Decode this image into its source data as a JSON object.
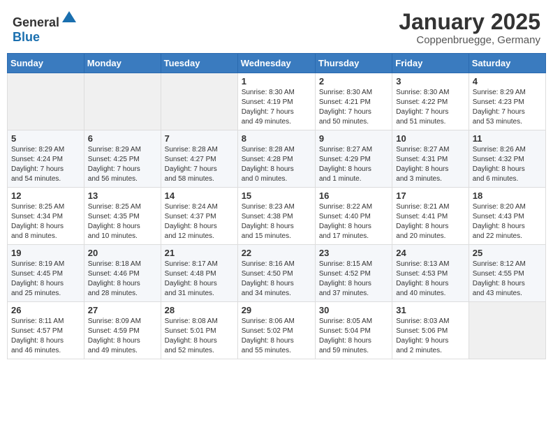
{
  "header": {
    "logo_general": "General",
    "logo_blue": "Blue",
    "title": "January 2025",
    "subtitle": "Coppenbruegge, Germany"
  },
  "weekdays": [
    "Sunday",
    "Monday",
    "Tuesday",
    "Wednesday",
    "Thursday",
    "Friday",
    "Saturday"
  ],
  "weeks": [
    [
      {
        "day": "",
        "info": ""
      },
      {
        "day": "",
        "info": ""
      },
      {
        "day": "",
        "info": ""
      },
      {
        "day": "1",
        "info": "Sunrise: 8:30 AM\nSunset: 4:19 PM\nDaylight: 7 hours\nand 49 minutes."
      },
      {
        "day": "2",
        "info": "Sunrise: 8:30 AM\nSunset: 4:21 PM\nDaylight: 7 hours\nand 50 minutes."
      },
      {
        "day": "3",
        "info": "Sunrise: 8:30 AM\nSunset: 4:22 PM\nDaylight: 7 hours\nand 51 minutes."
      },
      {
        "day": "4",
        "info": "Sunrise: 8:29 AM\nSunset: 4:23 PM\nDaylight: 7 hours\nand 53 minutes."
      }
    ],
    [
      {
        "day": "5",
        "info": "Sunrise: 8:29 AM\nSunset: 4:24 PM\nDaylight: 7 hours\nand 54 minutes."
      },
      {
        "day": "6",
        "info": "Sunrise: 8:29 AM\nSunset: 4:25 PM\nDaylight: 7 hours\nand 56 minutes."
      },
      {
        "day": "7",
        "info": "Sunrise: 8:28 AM\nSunset: 4:27 PM\nDaylight: 7 hours\nand 58 minutes."
      },
      {
        "day": "8",
        "info": "Sunrise: 8:28 AM\nSunset: 4:28 PM\nDaylight: 8 hours\nand 0 minutes."
      },
      {
        "day": "9",
        "info": "Sunrise: 8:27 AM\nSunset: 4:29 PM\nDaylight: 8 hours\nand 1 minute."
      },
      {
        "day": "10",
        "info": "Sunrise: 8:27 AM\nSunset: 4:31 PM\nDaylight: 8 hours\nand 3 minutes."
      },
      {
        "day": "11",
        "info": "Sunrise: 8:26 AM\nSunset: 4:32 PM\nDaylight: 8 hours\nand 6 minutes."
      }
    ],
    [
      {
        "day": "12",
        "info": "Sunrise: 8:25 AM\nSunset: 4:34 PM\nDaylight: 8 hours\nand 8 minutes."
      },
      {
        "day": "13",
        "info": "Sunrise: 8:25 AM\nSunset: 4:35 PM\nDaylight: 8 hours\nand 10 minutes."
      },
      {
        "day": "14",
        "info": "Sunrise: 8:24 AM\nSunset: 4:37 PM\nDaylight: 8 hours\nand 12 minutes."
      },
      {
        "day": "15",
        "info": "Sunrise: 8:23 AM\nSunset: 4:38 PM\nDaylight: 8 hours\nand 15 minutes."
      },
      {
        "day": "16",
        "info": "Sunrise: 8:22 AM\nSunset: 4:40 PM\nDaylight: 8 hours\nand 17 minutes."
      },
      {
        "day": "17",
        "info": "Sunrise: 8:21 AM\nSunset: 4:41 PM\nDaylight: 8 hours\nand 20 minutes."
      },
      {
        "day": "18",
        "info": "Sunrise: 8:20 AM\nSunset: 4:43 PM\nDaylight: 8 hours\nand 22 minutes."
      }
    ],
    [
      {
        "day": "19",
        "info": "Sunrise: 8:19 AM\nSunset: 4:45 PM\nDaylight: 8 hours\nand 25 minutes."
      },
      {
        "day": "20",
        "info": "Sunrise: 8:18 AM\nSunset: 4:46 PM\nDaylight: 8 hours\nand 28 minutes."
      },
      {
        "day": "21",
        "info": "Sunrise: 8:17 AM\nSunset: 4:48 PM\nDaylight: 8 hours\nand 31 minutes."
      },
      {
        "day": "22",
        "info": "Sunrise: 8:16 AM\nSunset: 4:50 PM\nDaylight: 8 hours\nand 34 minutes."
      },
      {
        "day": "23",
        "info": "Sunrise: 8:15 AM\nSunset: 4:52 PM\nDaylight: 8 hours\nand 37 minutes."
      },
      {
        "day": "24",
        "info": "Sunrise: 8:13 AM\nSunset: 4:53 PM\nDaylight: 8 hours\nand 40 minutes."
      },
      {
        "day": "25",
        "info": "Sunrise: 8:12 AM\nSunset: 4:55 PM\nDaylight: 8 hours\nand 43 minutes."
      }
    ],
    [
      {
        "day": "26",
        "info": "Sunrise: 8:11 AM\nSunset: 4:57 PM\nDaylight: 8 hours\nand 46 minutes."
      },
      {
        "day": "27",
        "info": "Sunrise: 8:09 AM\nSunset: 4:59 PM\nDaylight: 8 hours\nand 49 minutes."
      },
      {
        "day": "28",
        "info": "Sunrise: 8:08 AM\nSunset: 5:01 PM\nDaylight: 8 hours\nand 52 minutes."
      },
      {
        "day": "29",
        "info": "Sunrise: 8:06 AM\nSunset: 5:02 PM\nDaylight: 8 hours\nand 55 minutes."
      },
      {
        "day": "30",
        "info": "Sunrise: 8:05 AM\nSunset: 5:04 PM\nDaylight: 8 hours\nand 59 minutes."
      },
      {
        "day": "31",
        "info": "Sunrise: 8:03 AM\nSunset: 5:06 PM\nDaylight: 9 hours\nand 2 minutes."
      },
      {
        "day": "",
        "info": ""
      }
    ]
  ]
}
